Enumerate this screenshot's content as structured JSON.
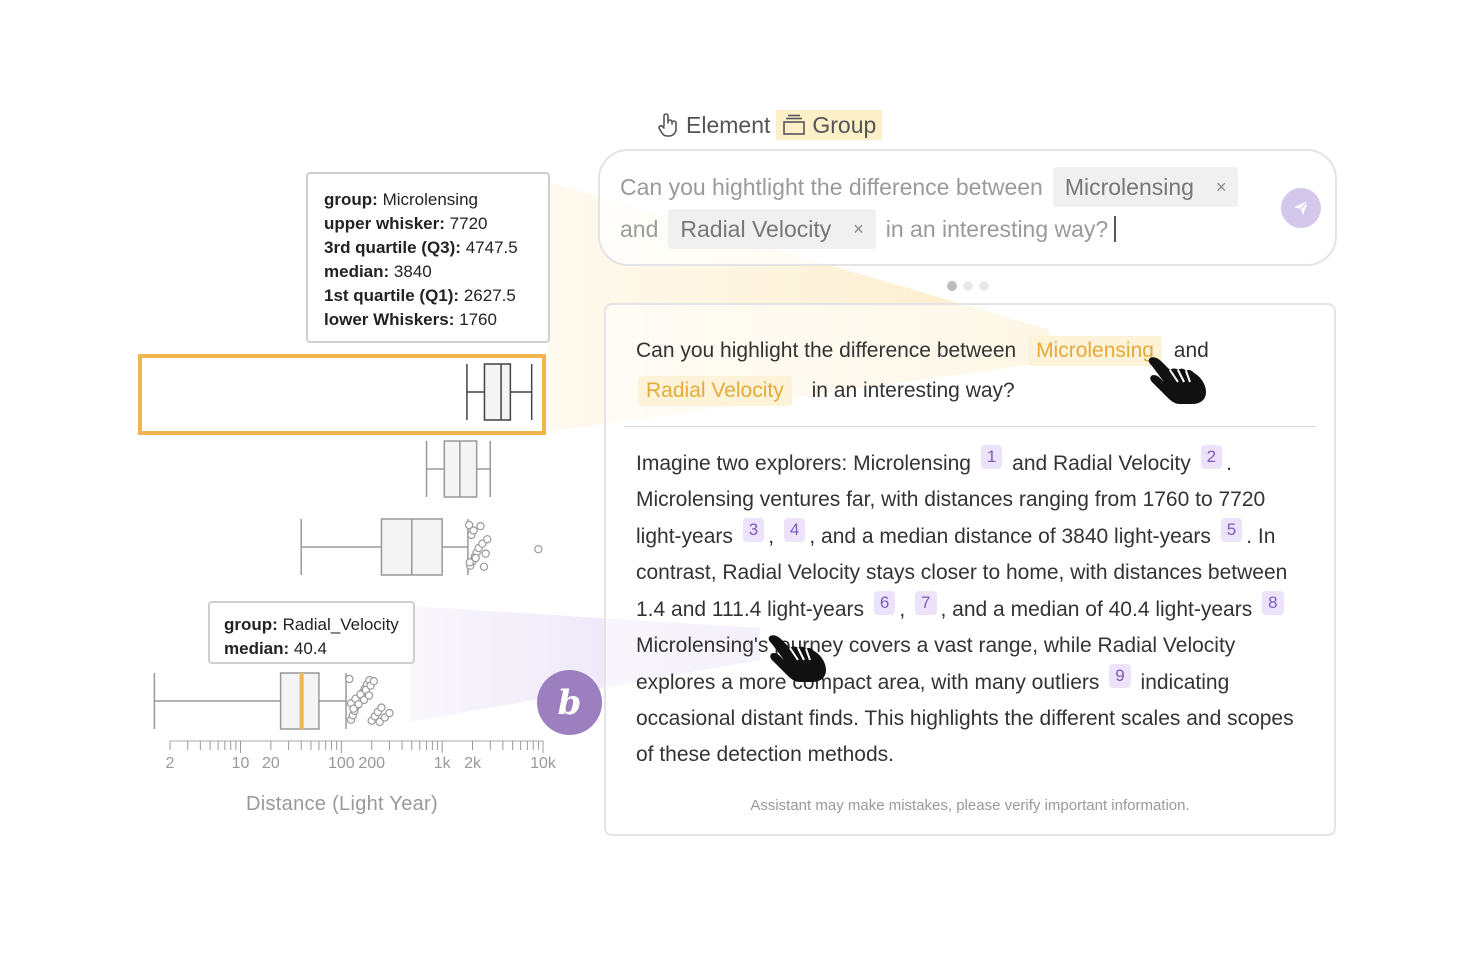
{
  "mode_bar": {
    "element_label": "Element",
    "group_label": "Group",
    "active": "Group"
  },
  "input": {
    "prefix": "Can you hightlight the difference between",
    "chip1": "Microlensing",
    "middle": "and",
    "chip2": "Radial Velocity",
    "suffix": "in an interesting way?",
    "remove_glyph": "×",
    "send_icon": "paper-plane-icon"
  },
  "carousel": {
    "count": 3,
    "active": 1
  },
  "chat": {
    "question": {
      "prefix": "Can you highlight the difference between",
      "term1": "Microlensing",
      "mid": "and",
      "term2": "Radial Velocity",
      "suffix": "in an interesting way?"
    },
    "answer": {
      "s1": "Imagine two explorers: Microlensing",
      "s2": "and Radial Velocity",
      "s3": ". Microlensing ventures far, with distances ranging from 1760 to 7720 light-years",
      "s4": ",",
      "s5": ", and a median distance of 3840 light-years",
      "s6": ". In contrast, Radial Velocity stays closer to home, with distances between 1.4 and 111.4 light-years",
      "s7": ",",
      "s8": ", and a median of 40.4 light-years",
      "s9": "Microlensing's journey covers a vast range, while Radial Velocity explores a more compact area, with many outliers",
      "s10": "indicating occasional distant finds. This highlights the different scales and scopes of these detection methods.",
      "refs": [
        "1",
        "2",
        "3",
        "4",
        "5",
        "6",
        "7",
        "8",
        "9"
      ]
    },
    "disclaimer": "Assistant may make mistakes, please verify important information."
  },
  "tooltip_microlensing": {
    "group_label": "group:",
    "group_value": "Microlensing",
    "upper_label": "upper whisker:",
    "upper_value": "7720",
    "q3_label": "3rd quartile (Q3):",
    "q3_value": "4747.5",
    "median_label": "median:",
    "median_value": "3840",
    "q1_label": "1st quartile (Q1):",
    "q1_value": "2627.5",
    "lower_label": "lower Whiskers:",
    "lower_value": "1760"
  },
  "tooltip_radial": {
    "group_label": "group:",
    "group_value": "Radial_Velocity",
    "median_label": "median:",
    "median_value": "40.4"
  },
  "badge": "b",
  "colors": {
    "highlight": "#f0b54d",
    "accent_purple": "#9c7fbf",
    "box_stroke": "#555555"
  },
  "chart_data": {
    "type": "boxplot",
    "xlabel": "Distance (Light Year)",
    "x_scale": "log",
    "xlim": [
      1.5,
      10000
    ],
    "tick_labels": [
      {
        "label": "2",
        "value": 2
      },
      {
        "label": "10",
        "value": 10
      },
      {
        "label": "20",
        "value": 20
      },
      {
        "label": "100",
        "value": 100
      },
      {
        "label": "200",
        "value": 200
      },
      {
        "label": "1k",
        "value": 1000
      },
      {
        "label": "2k",
        "value": 2000
      },
      {
        "label": "10k",
        "value": 10000
      }
    ],
    "boxes": [
      {
        "group": "Microlensing",
        "lower": 1760,
        "q1": 2627.5,
        "median": 3840,
        "q3": 4747.5,
        "upper": 7720,
        "highlighted": true,
        "outliers": []
      },
      {
        "group": "",
        "lower": 700,
        "q1": 1050,
        "median": 1500,
        "q3": 2200,
        "upper": 3000,
        "highlighted": false,
        "outliers": []
      },
      {
        "group": "",
        "lower": 40,
        "q1": 250,
        "median": 500,
        "q3": 1000,
        "upper": 1800,
        "highlighted": false,
        "outliers": [
          1850,
          1900,
          2000,
          2100,
          2200,
          2300,
          2500,
          2800,
          1950,
          2050,
          2400,
          2600,
          1880,
          2150,
          2700,
          9000
        ]
      },
      {
        "group": "Radial_Velocity",
        "lower": 1.4,
        "q1": 25,
        "median": 40.4,
        "q3": 60,
        "upper": 111.4,
        "highlighted": false,
        "median_color": "#f0b54d",
        "outliers": [
          120,
          125,
          130,
          135,
          140,
          145,
          150,
          160,
          170,
          180,
          190,
          200,
          215,
          230,
          250,
          125,
          138,
          155,
          175,
          195,
          210,
          240,
          270,
          300,
          132,
          148,
          168,
          188
        ]
      }
    ]
  }
}
